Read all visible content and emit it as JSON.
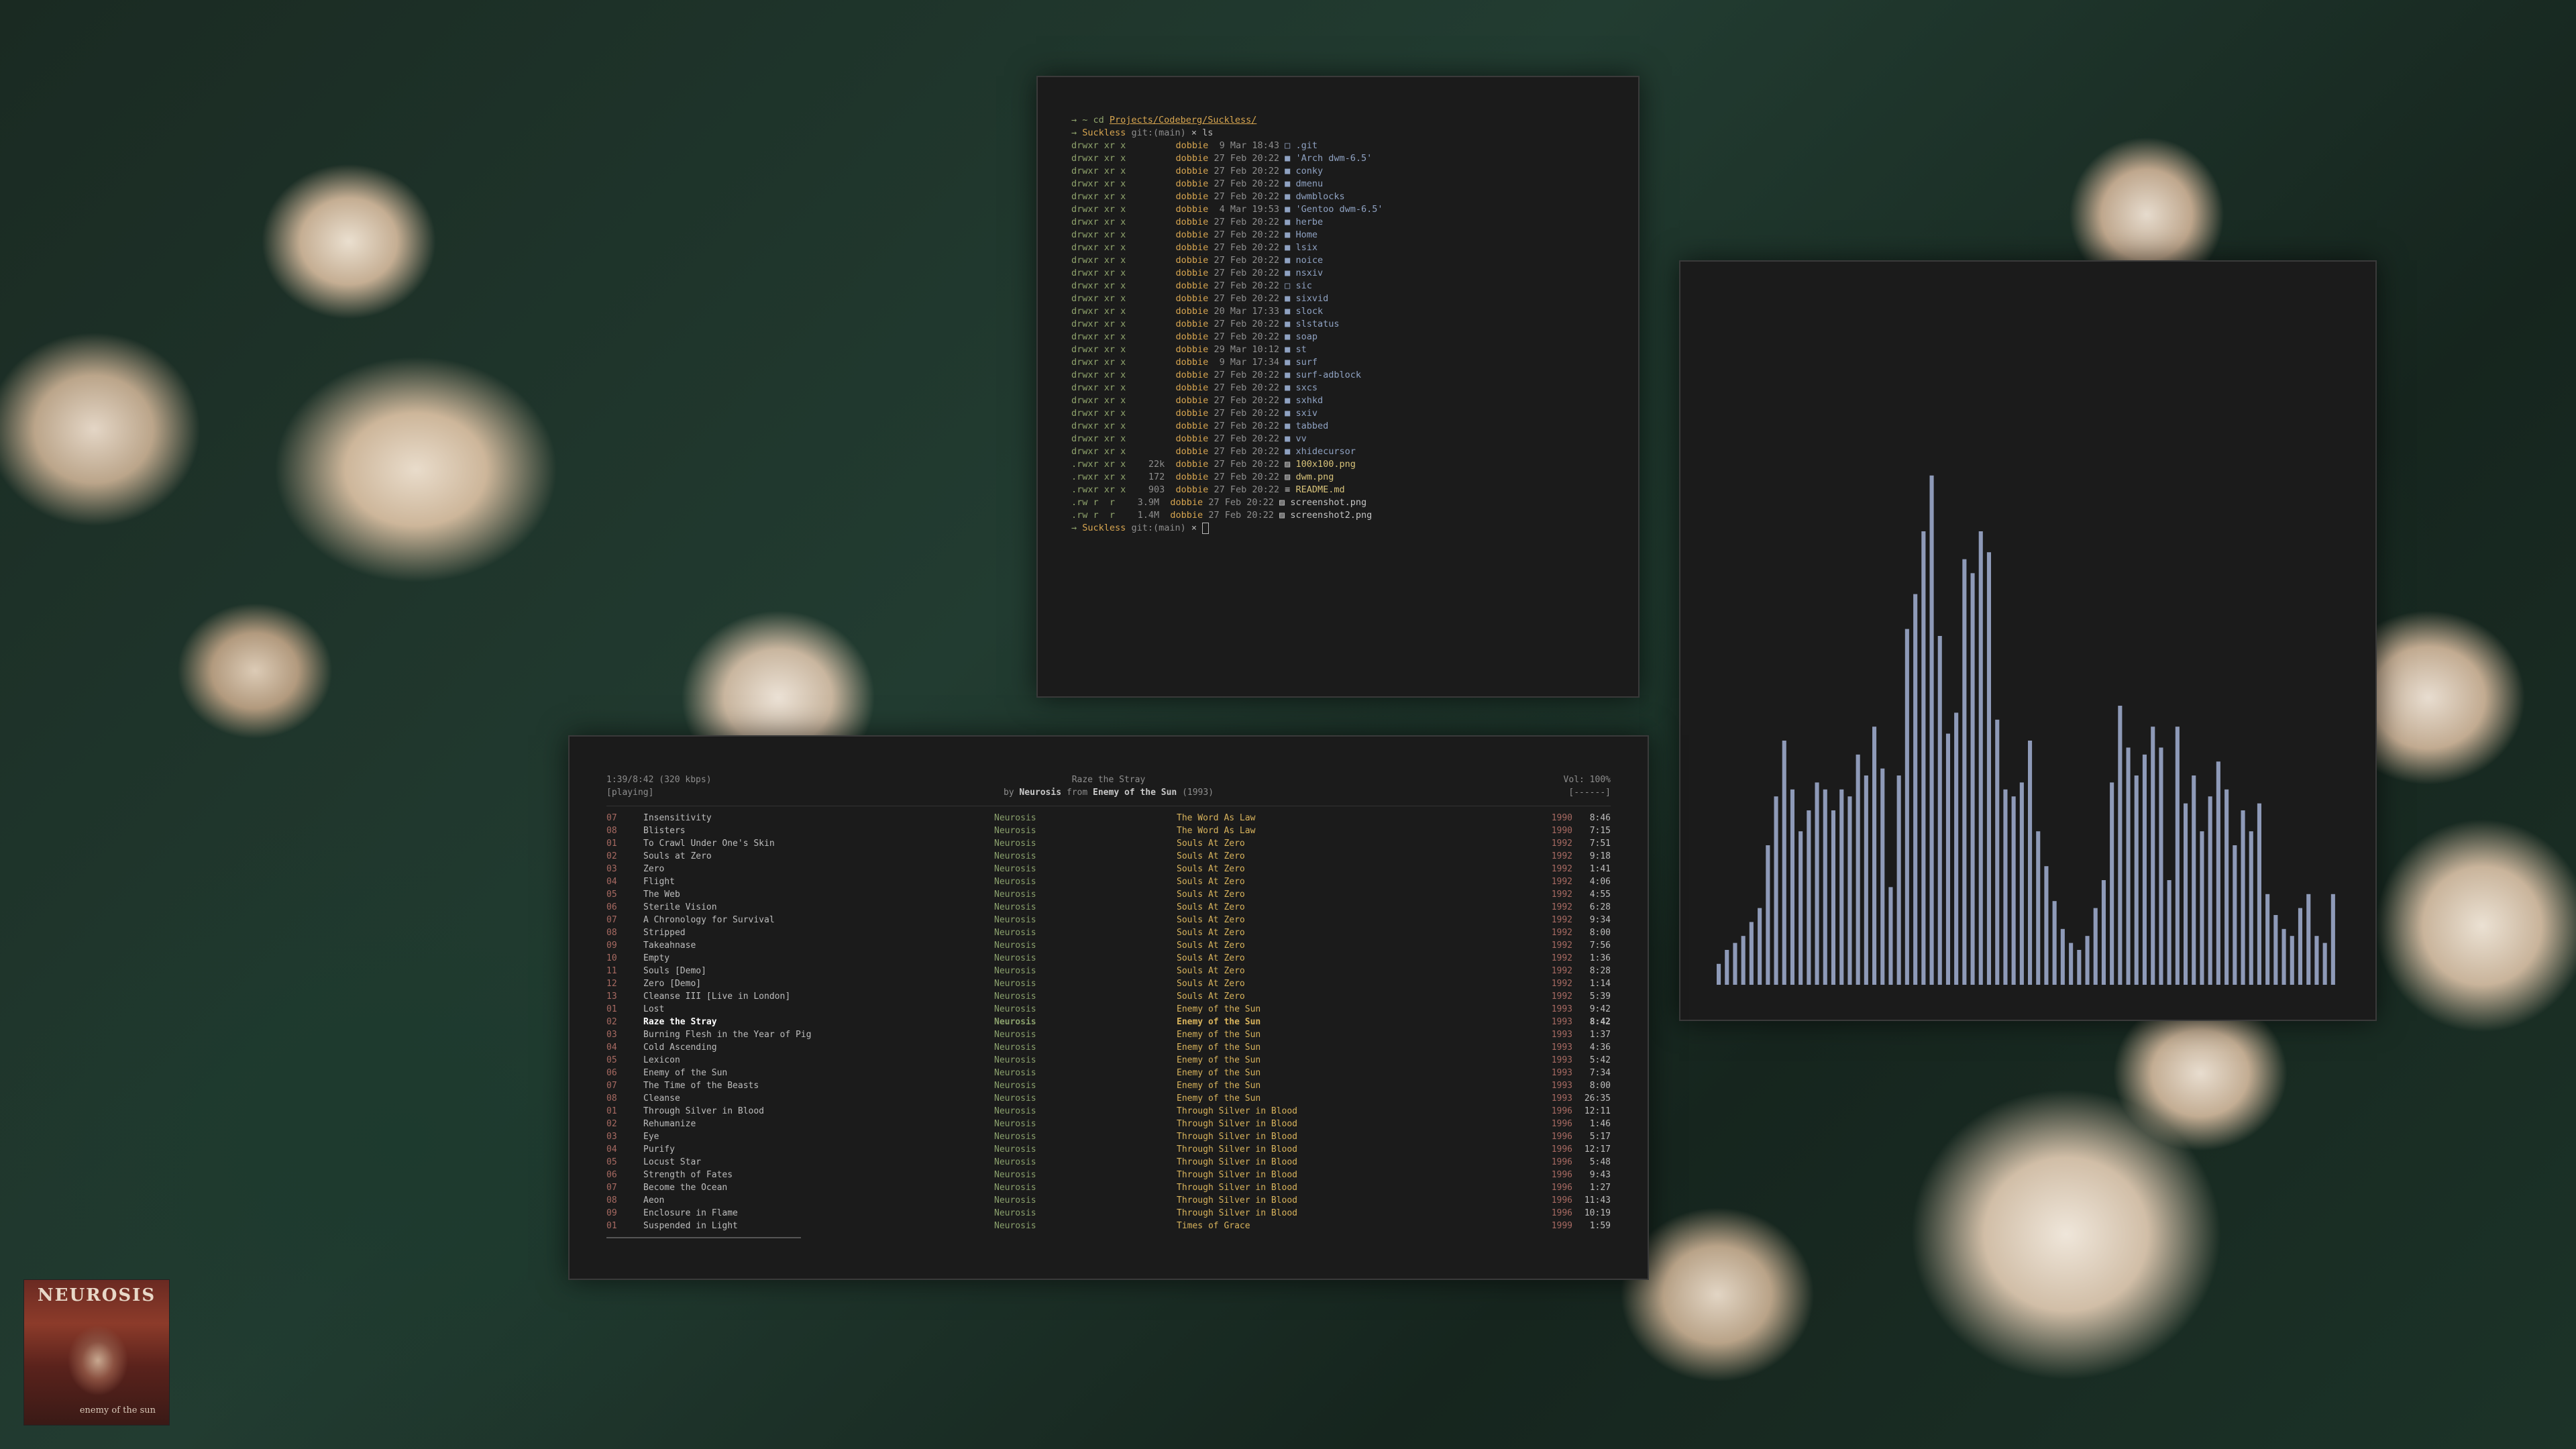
{
  "terminal": {
    "cmd_prompt": "→ ~ cd ",
    "cmd_path": "Projects/Codeberg/Suckless/",
    "ls_arrow": "→",
    "ls_dir": "Suckless",
    "ls_git": "git:(main)",
    "ls_cmd": "× ls",
    "end_arrow": "→",
    "end_dir": "Suckless",
    "end_git": "git:(main)",
    "end_x": "×",
    "entries": [
      {
        "perm": "drwxr xr x",
        "size": "",
        "user": "dobbie",
        "date": " 9 Mar 18:43",
        "icon": "□",
        "name": ".git",
        "kind": "dir"
      },
      {
        "perm": "drwxr xr x",
        "size": "",
        "user": "dobbie",
        "date": "27 Feb 20:22",
        "icon": "■",
        "name": "'Arch dwm-6.5'",
        "kind": "dir"
      },
      {
        "perm": "drwxr xr x",
        "size": "",
        "user": "dobbie",
        "date": "27 Feb 20:22",
        "icon": "■",
        "name": "conky",
        "kind": "dir"
      },
      {
        "perm": "drwxr xr x",
        "size": "",
        "user": "dobbie",
        "date": "27 Feb 20:22",
        "icon": "■",
        "name": "dmenu",
        "kind": "dir"
      },
      {
        "perm": "drwxr xr x",
        "size": "",
        "user": "dobbie",
        "date": "27 Feb 20:22",
        "icon": "■",
        "name": "dwmblocks",
        "kind": "dir"
      },
      {
        "perm": "drwxr xr x",
        "size": "",
        "user": "dobbie",
        "date": " 4 Mar 19:53",
        "icon": "■",
        "name": "'Gentoo dwm-6.5'",
        "kind": "dir"
      },
      {
        "perm": "drwxr xr x",
        "size": "",
        "user": "dobbie",
        "date": "27 Feb 20:22",
        "icon": "■",
        "name": "herbe",
        "kind": "dir"
      },
      {
        "perm": "drwxr xr x",
        "size": "",
        "user": "dobbie",
        "date": "27 Feb 20:22",
        "icon": "■",
        "name": "Home",
        "kind": "dir"
      },
      {
        "perm": "drwxr xr x",
        "size": "",
        "user": "dobbie",
        "date": "27 Feb 20:22",
        "icon": "■",
        "name": "lsix",
        "kind": "dir"
      },
      {
        "perm": "drwxr xr x",
        "size": "",
        "user": "dobbie",
        "date": "27 Feb 20:22",
        "icon": "■",
        "name": "noice",
        "kind": "dir"
      },
      {
        "perm": "drwxr xr x",
        "size": "",
        "user": "dobbie",
        "date": "27 Feb 20:22",
        "icon": "■",
        "name": "nsxiv",
        "kind": "dir"
      },
      {
        "perm": "drwxr xr x",
        "size": "",
        "user": "dobbie",
        "date": "27 Feb 20:22",
        "icon": "□",
        "name": "sic",
        "kind": "dir"
      },
      {
        "perm": "drwxr xr x",
        "size": "",
        "user": "dobbie",
        "date": "27 Feb 20:22",
        "icon": "■",
        "name": "sixvid",
        "kind": "dir"
      },
      {
        "perm": "drwxr xr x",
        "size": "",
        "user": "dobbie",
        "date": "20 Mar 17:33",
        "icon": "■",
        "name": "slock",
        "kind": "dir"
      },
      {
        "perm": "drwxr xr x",
        "size": "",
        "user": "dobbie",
        "date": "27 Feb 20:22",
        "icon": "■",
        "name": "slstatus",
        "kind": "dir"
      },
      {
        "perm": "drwxr xr x",
        "size": "",
        "user": "dobbie",
        "date": "27 Feb 20:22",
        "icon": "■",
        "name": "soap",
        "kind": "dir"
      },
      {
        "perm": "drwxr xr x",
        "size": "",
        "user": "dobbie",
        "date": "29 Mar 10:12",
        "icon": "■",
        "name": "st",
        "kind": "dir"
      },
      {
        "perm": "drwxr xr x",
        "size": "",
        "user": "dobbie",
        "date": " 9 Mar 17:34",
        "icon": "■",
        "name": "surf",
        "kind": "dir"
      },
      {
        "perm": "drwxr xr x",
        "size": "",
        "user": "dobbie",
        "date": "27 Feb 20:22",
        "icon": "■",
        "name": "surf-adblock",
        "kind": "dir"
      },
      {
        "perm": "drwxr xr x",
        "size": "",
        "user": "dobbie",
        "date": "27 Feb 20:22",
        "icon": "■",
        "name": "sxcs",
        "kind": "dir"
      },
      {
        "perm": "drwxr xr x",
        "size": "",
        "user": "dobbie",
        "date": "27 Feb 20:22",
        "icon": "■",
        "name": "sxhkd",
        "kind": "dir"
      },
      {
        "perm": "drwxr xr x",
        "size": "",
        "user": "dobbie",
        "date": "27 Feb 20:22",
        "icon": "■",
        "name": "sxiv",
        "kind": "dir"
      },
      {
        "perm": "drwxr xr x",
        "size": "",
        "user": "dobbie",
        "date": "27 Feb 20:22",
        "icon": "■",
        "name": "tabbed",
        "kind": "dir"
      },
      {
        "perm": "drwxr xr x",
        "size": "",
        "user": "dobbie",
        "date": "27 Feb 20:22",
        "icon": "■",
        "name": "vv",
        "kind": "dir"
      },
      {
        "perm": "drwxr xr x",
        "size": "",
        "user": "dobbie",
        "date": "27 Feb 20:22",
        "icon": "■",
        "name": "xhidecursor",
        "kind": "dir"
      },
      {
        "perm": ".rwxr xr x",
        "size": "22k",
        "user": "dobbie",
        "date": "27 Feb 20:22",
        "icon": "▨",
        "name": "100x100.png",
        "kind": "exe"
      },
      {
        "perm": ".rwxr xr x",
        "size": "172",
        "user": "dobbie",
        "date": "27 Feb 20:22",
        "icon": "▨",
        "name": "dwm.png",
        "kind": "exe"
      },
      {
        "perm": ".rwxr xr x",
        "size": "903",
        "user": "dobbie",
        "date": "27 Feb 20:22",
        "icon": "≡",
        "name": "README.md",
        "kind": "exe"
      },
      {
        "perm": ".rw r  r ",
        "size": "3.9M",
        "user": "dobbie",
        "date": "27 Feb 20:22",
        "icon": "▨",
        "name": "screenshot.png",
        "kind": "file"
      },
      {
        "perm": ".rw r  r ",
        "size": "1.4M",
        "user": "dobbie",
        "date": "27 Feb 20:22",
        "icon": "▨",
        "name": "screenshot2.png",
        "kind": "file"
      }
    ]
  },
  "player": {
    "time_info": "1:39/8:42 (320 kbps)",
    "status": "[playing]",
    "now_title": "Raze the Stray",
    "by_word": "by",
    "now_artist": "Neurosis",
    "from_word": "from",
    "now_album": "Enemy of the Sun",
    "now_year": "(1993)",
    "volume": "Vol: 100%",
    "volume_bar": "[------]",
    "current_index": 16,
    "tracks": [
      {
        "num": "07",
        "title": "Insensitivity",
        "artist": "Neurosis",
        "album": "The Word As Law",
        "year": "1990",
        "len": "8:46"
      },
      {
        "num": "08",
        "title": "Blisters",
        "artist": "Neurosis",
        "album": "The Word As Law",
        "year": "1990",
        "len": "7:15"
      },
      {
        "num": "01",
        "title": "To Crawl Under One's Skin",
        "artist": "Neurosis",
        "album": "Souls At Zero",
        "year": "1992",
        "len": "7:51"
      },
      {
        "num": "02",
        "title": "Souls at Zero",
        "artist": "Neurosis",
        "album": "Souls At Zero",
        "year": "1992",
        "len": "9:18"
      },
      {
        "num": "03",
        "title": "Zero",
        "artist": "Neurosis",
        "album": "Souls At Zero",
        "year": "1992",
        "len": "1:41"
      },
      {
        "num": "04",
        "title": "Flight",
        "artist": "Neurosis",
        "album": "Souls At Zero",
        "year": "1992",
        "len": "4:06"
      },
      {
        "num": "05",
        "title": "The Web",
        "artist": "Neurosis",
        "album": "Souls At Zero",
        "year": "1992",
        "len": "4:55"
      },
      {
        "num": "06",
        "title": "Sterile Vision",
        "artist": "Neurosis",
        "album": "Souls At Zero",
        "year": "1992",
        "len": "6:28"
      },
      {
        "num": "07",
        "title": "A Chronology for Survival",
        "artist": "Neurosis",
        "album": "Souls At Zero",
        "year": "1992",
        "len": "9:34"
      },
      {
        "num": "08",
        "title": "Stripped",
        "artist": "Neurosis",
        "album": "Souls At Zero",
        "year": "1992",
        "len": "8:00"
      },
      {
        "num": "09",
        "title": "Takeahnase",
        "artist": "Neurosis",
        "album": "Souls At Zero",
        "year": "1992",
        "len": "7:56"
      },
      {
        "num": "10",
        "title": "Empty",
        "artist": "Neurosis",
        "album": "Souls At Zero",
        "year": "1992",
        "len": "1:36"
      },
      {
        "num": "11",
        "title": "Souls [Demo]",
        "artist": "Neurosis",
        "album": "Souls At Zero",
        "year": "1992",
        "len": "8:28"
      },
      {
        "num": "12",
        "title": "Zero [Demo]",
        "artist": "Neurosis",
        "album": "Souls At Zero",
        "year": "1992",
        "len": "1:14"
      },
      {
        "num": "13",
        "title": "Cleanse III [Live in London]",
        "artist": "Neurosis",
        "album": "Souls At Zero",
        "year": "1992",
        "len": "5:39"
      },
      {
        "num": "01",
        "title": "Lost",
        "artist": "Neurosis",
        "album": "Enemy of the Sun",
        "year": "1993",
        "len": "9:42"
      },
      {
        "num": "02",
        "title": "Raze the Stray",
        "artist": "Neurosis",
        "album": "Enemy of the Sun",
        "year": "1993",
        "len": "8:42"
      },
      {
        "num": "03",
        "title": "Burning Flesh in the Year of Pig",
        "artist": "Neurosis",
        "album": "Enemy of the Sun",
        "year": "1993",
        "len": "1:37"
      },
      {
        "num": "04",
        "title": "Cold Ascending",
        "artist": "Neurosis",
        "album": "Enemy of the Sun",
        "year": "1993",
        "len": "4:36"
      },
      {
        "num": "05",
        "title": "Lexicon",
        "artist": "Neurosis",
        "album": "Enemy of the Sun",
        "year": "1993",
        "len": "5:42"
      },
      {
        "num": "06",
        "title": "Enemy of the Sun",
        "artist": "Neurosis",
        "album": "Enemy of the Sun",
        "year": "1993",
        "len": "7:34"
      },
      {
        "num": "07",
        "title": "The Time of the Beasts",
        "artist": "Neurosis",
        "album": "Enemy of the Sun",
        "year": "1993",
        "len": "8:00"
      },
      {
        "num": "08",
        "title": "Cleanse",
        "artist": "Neurosis",
        "album": "Enemy of the Sun",
        "year": "1993",
        "len": "26:35"
      },
      {
        "num": "01",
        "title": "Through Silver in Blood",
        "artist": "Neurosis",
        "album": "Through Silver in Blood",
        "year": "1996",
        "len": "12:11"
      },
      {
        "num": "02",
        "title": "Rehumanize",
        "artist": "Neurosis",
        "album": "Through Silver in Blood",
        "year": "1996",
        "len": "1:46"
      },
      {
        "num": "03",
        "title": "Eye",
        "artist": "Neurosis",
        "album": "Through Silver in Blood",
        "year": "1996",
        "len": "5:17"
      },
      {
        "num": "04",
        "title": "Purify",
        "artist": "Neurosis",
        "album": "Through Silver in Blood",
        "year": "1996",
        "len": "12:17"
      },
      {
        "num": "05",
        "title": "Locust Star",
        "artist": "Neurosis",
        "album": "Through Silver in Blood",
        "year": "1996",
        "len": "5:48"
      },
      {
        "num": "06",
        "title": "Strength of Fates",
        "artist": "Neurosis",
        "album": "Through Silver in Blood",
        "year": "1996",
        "len": "9:43"
      },
      {
        "num": "07",
        "title": "Become the Ocean",
        "artist": "Neurosis",
        "album": "Through Silver in Blood",
        "year": "1996",
        "len": "1:27"
      },
      {
        "num": "08",
        "title": "Aeon",
        "artist": "Neurosis",
        "album": "Through Silver in Blood",
        "year": "1996",
        "len": "11:43"
      },
      {
        "num": "09",
        "title": "Enclosure in Flame",
        "artist": "Neurosis",
        "album": "Through Silver in Blood",
        "year": "1996",
        "len": "10:19"
      },
      {
        "num": "01",
        "title": "Suspended in Light",
        "artist": "Neurosis",
        "album": "Times of Grace",
        "year": "1999",
        "len": "1:59"
      }
    ]
  },
  "visualizer": {
    "bar_color": "#8e9ab8",
    "levels": [
      0.03,
      0.05,
      0.06,
      0.07,
      0.09,
      0.11,
      0.2,
      0.27,
      0.35,
      0.28,
      0.22,
      0.25,
      0.29,
      0.28,
      0.25,
      0.28,
      0.27,
      0.33,
      0.3,
      0.37,
      0.31,
      0.14,
      0.3,
      0.51,
      0.56,
      0.65,
      0.73,
      0.5,
      0.36,
      0.39,
      0.61,
      0.59,
      0.65,
      0.62,
      0.38,
      0.28,
      0.27,
      0.29,
      0.35,
      0.22,
      0.17,
      0.12,
      0.08,
      0.06,
      0.05,
      0.07,
      0.11,
      0.15,
      0.29,
      0.4,
      0.34,
      0.3,
      0.33,
      0.37,
      0.34,
      0.15,
      0.37,
      0.26,
      0.3,
      0.22,
      0.27,
      0.32,
      0.28,
      0.2,
      0.25,
      0.22,
      0.26,
      0.13,
      0.1,
      0.08,
      0.07,
      0.11,
      0.13,
      0.07,
      0.06,
      0.13
    ],
    "shape": [
      0.03,
      0.05,
      0.06,
      0.07,
      0.09,
      0.11,
      0.2,
      0.27,
      0.35,
      0.28,
      0.22,
      0.25,
      0.29,
      0.28,
      0.25,
      0.28,
      0.27,
      0.33,
      0.3,
      0.37,
      0.31,
      0.14,
      0.3,
      0.51,
      0.56,
      0.65,
      0.73,
      0.5,
      0.36,
      0.39,
      0.61,
      0.59,
      0.65,
      0.62,
      0.38,
      0.28,
      0.27,
      0.29,
      0.35,
      0.22,
      0.17,
      0.12,
      0.08,
      0.06,
      0.05,
      0.07,
      0.11,
      0.15,
      0.29,
      0.4,
      0.34,
      0.3,
      0.33,
      0.37,
      0.34,
      0.15,
      0.37,
      0.26,
      0.3,
      0.22,
      0.27,
      0.32,
      0.28,
      0.2,
      0.25,
      0.22,
      0.26,
      0.13,
      0.1,
      0.08,
      0.07,
      0.11,
      0.13,
      0.07,
      0.06,
      0.13
    ]
  },
  "album_art": {
    "title": "NEUROSIS",
    "subtitle": "enemy of the sun"
  }
}
